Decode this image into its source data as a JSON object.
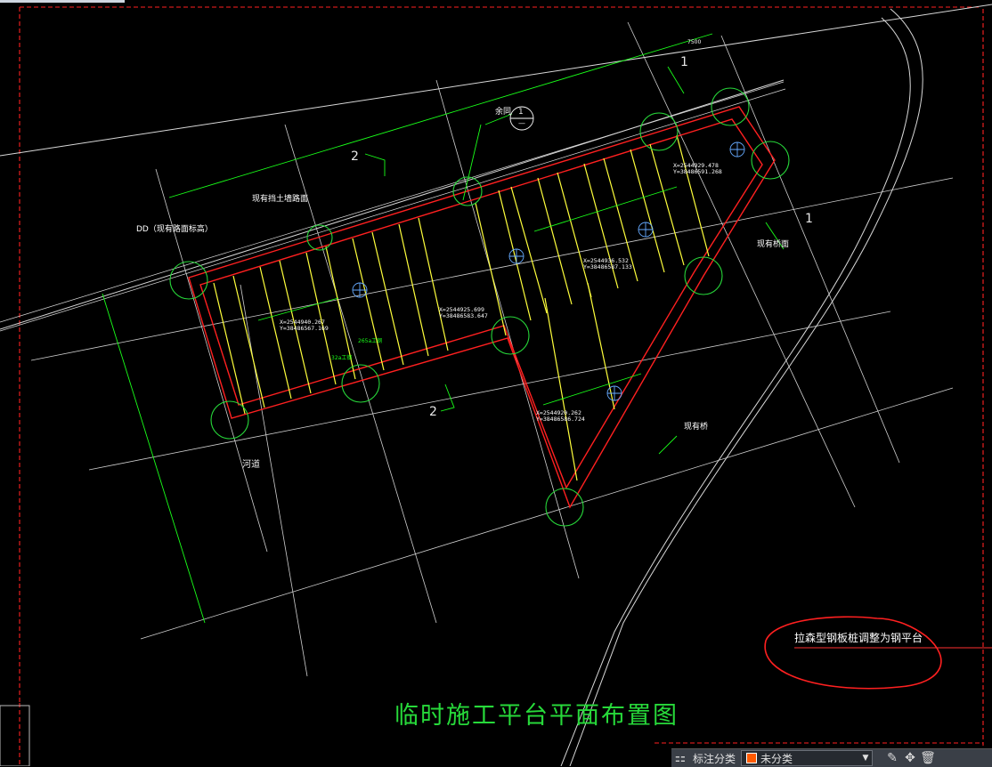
{
  "drawing": {
    "title": "临时施工平台平面布置图",
    "note": "拉森型钢板桩调整为钢平台",
    "labels": {
      "road_elev": "DD（现有路面标高）",
      "retaining_road": "现有挡土墙路面",
      "river": "河道",
      "existing_bridge_deck": "现有桥面",
      "existing_bridge": "现有桥",
      "dim_top": "7500",
      "section_1_top": "1",
      "section_1_right": "1",
      "section_2_top": "2",
      "section_2_bottom": "2",
      "detail_ref": "余同",
      "detail_num": "1",
      "detail_sub": "—",
      "beam_spec_1": "265a工钢",
      "beam_spec_2": "32a工钢"
    },
    "coords": [
      {
        "x": "X=2544940.267",
        "y": "Y=38486567.169"
      },
      {
        "x": "X=2544925.699",
        "y": "Y=38486583.647"
      },
      {
        "x": "X=2544936.532",
        "y": "Y=38486587.133"
      },
      {
        "x": "X=2544929.478",
        "y": "Y=38486591.268"
      },
      {
        "x": "X=2544920.262",
        "y": "Y=38486586.724"
      }
    ]
  },
  "statusbar": {
    "label": "标注分类",
    "category": "未分类",
    "swatch_color": "#ff5a00"
  },
  "colors": {
    "background": "#000000",
    "grid_line": "#d0d0d0",
    "dimension": "#19ff19",
    "steel_beam": "#ffff3c",
    "pile_outline": "#ff2020",
    "pile_circle": "#27d93a",
    "markup": "#ff2020",
    "road_edge": "#d8d8d8"
  }
}
